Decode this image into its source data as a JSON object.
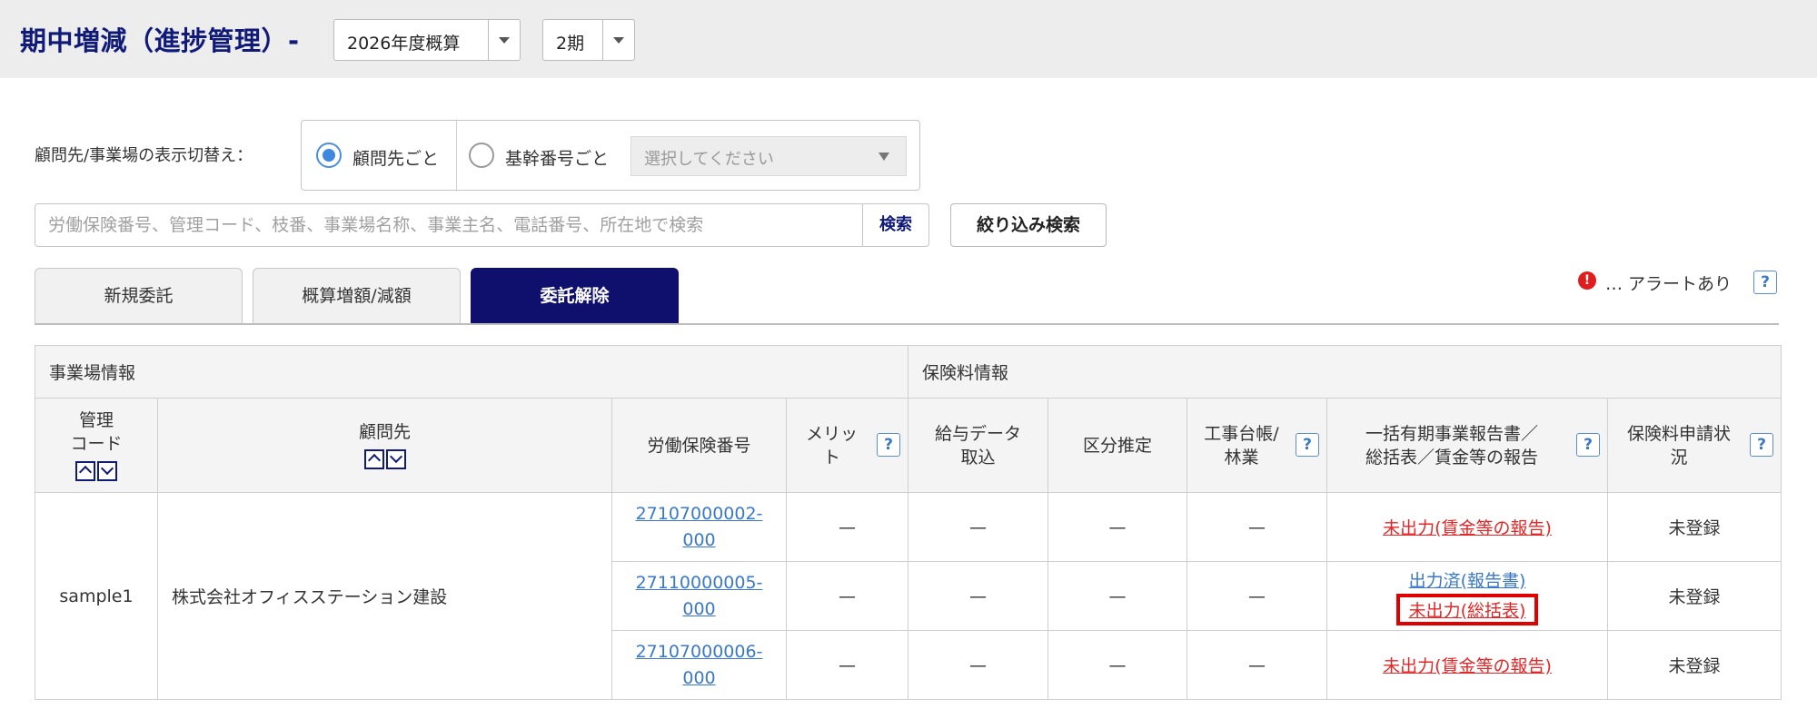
{
  "header": {
    "title": "期中増減（進捗管理）-",
    "year_select": "2026年度概算",
    "period_select": "2期"
  },
  "filters": {
    "switch_label": "顧問先/事業場の表示切替え：",
    "radio_client": "顧問先ごと",
    "radio_base": "基幹番号ごと",
    "base_placeholder": "選択してください",
    "search_placeholder": "労働保険番号、管理コード、枝番、事業場名称、事業主名、電話番号、所在地で検索",
    "search_button": "検索",
    "filter_button": "絞り込み検索"
  },
  "tabs": [
    "新規委託",
    "概算増額/減額",
    "委託解除"
  ],
  "active_tab": 2,
  "alert": {
    "icon_text": "!",
    "text": "… アラートあり"
  },
  "help_glyph": "?",
  "table": {
    "group1": "事業場情報",
    "group2": "保険料情報",
    "headers": {
      "code_line1": "管理",
      "code_line2": "コード",
      "client": "顧問先",
      "labor_no": "労働保険番号",
      "merit_line1": "メリッ",
      "merit_line2": "ト",
      "payroll_line1": "給与データ",
      "payroll_line2": "取込",
      "category": "区分推定",
      "ledger_line1": "工事台帳/",
      "ledger_line2": "林業",
      "report_line1": "一括有期事業報告書／",
      "report_line2": "総括表／賃金等の報告",
      "status_line1": "保険料申請状",
      "status_line2": "況"
    },
    "code": "sample1",
    "client_name": "株式会社オフィスステーション建設",
    "rows": [
      {
        "labor_no_1": "27107000002-",
        "labor_no_2": "000",
        "merit": "—",
        "payroll": "—",
        "category": "—",
        "ledger": "—",
        "report": "未出力(賃金等の報告)",
        "status": "未登録"
      },
      {
        "labor_no_1": "27110000005-",
        "labor_no_2": "000",
        "merit": "—",
        "payroll": "—",
        "category": "—",
        "ledger": "—",
        "report_done": "出力済(報告書)",
        "report": "未出力(総括表)",
        "status": "未登録"
      },
      {
        "labor_no_1": "27107000006-",
        "labor_no_2": "000",
        "merit": "—",
        "payroll": "—",
        "category": "—",
        "ledger": "—",
        "report": "未出力(賃金等の報告)",
        "status": "未登録"
      }
    ]
  }
}
